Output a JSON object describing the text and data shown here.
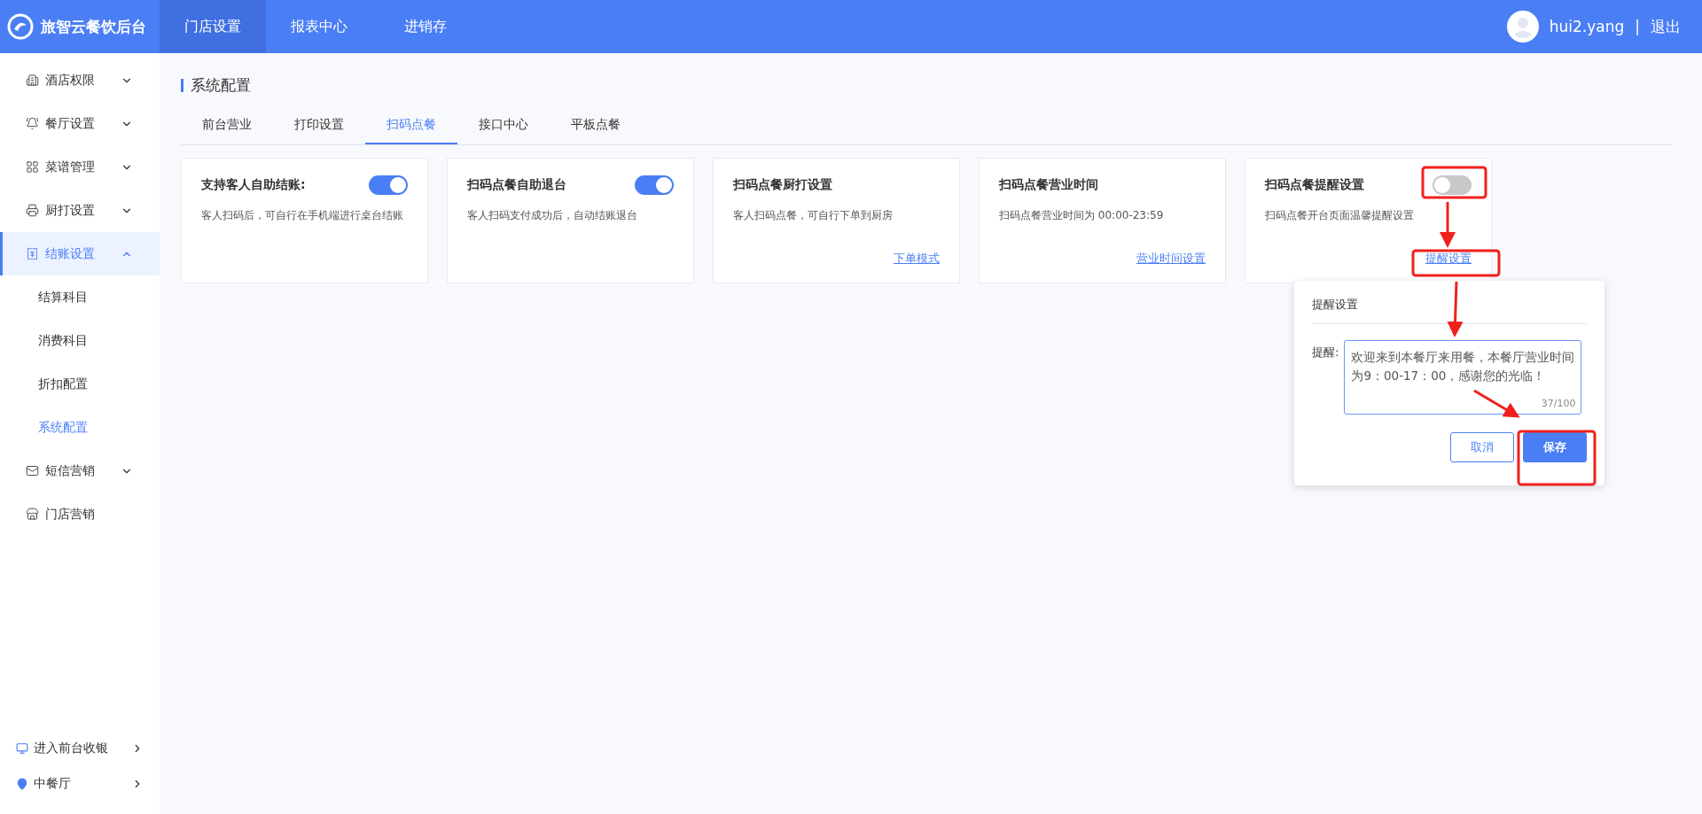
{
  "header": {
    "logo_text": "旅智云餐饮后台",
    "nav": [
      {
        "label": "门店设置",
        "selected": true
      },
      {
        "label": "报表中心",
        "selected": false
      },
      {
        "label": "进销存",
        "selected": false
      }
    ],
    "user": "hui2.yang",
    "separator": "|",
    "logout": "退出"
  },
  "sidebar": {
    "items": [
      {
        "label": "酒店权限",
        "expanded": false,
        "selected": false
      },
      {
        "label": "餐厅设置",
        "expanded": false,
        "selected": false
      },
      {
        "label": "菜谱管理",
        "expanded": false,
        "selected": false
      },
      {
        "label": "厨打设置",
        "expanded": false,
        "selected": false
      },
      {
        "label": "结账设置",
        "expanded": true,
        "selected": true,
        "children": [
          {
            "label": "结算科目",
            "selected": false
          },
          {
            "label": "消费科目",
            "selected": false
          },
          {
            "label": "折扣配置",
            "selected": false
          },
          {
            "label": "系统配置",
            "selected": true
          }
        ]
      },
      {
        "label": "短信营销",
        "expanded": false,
        "selected": false
      },
      {
        "label": "门店营销",
        "selected": false
      }
    ],
    "footer": [
      {
        "label": "进入前台收银"
      },
      {
        "label": "中餐厅"
      }
    ]
  },
  "page": {
    "title": "系统配置",
    "tabs": [
      {
        "label": "前台营业",
        "selected": false
      },
      {
        "label": "打印设置",
        "selected": false
      },
      {
        "label": "扫码点餐",
        "selected": true
      },
      {
        "label": "接口中心",
        "selected": false
      },
      {
        "label": "平板点餐",
        "selected": false
      }
    ],
    "cards": [
      {
        "title": "支持客人自助结账:",
        "on": true,
        "description": "客人扫码后，可自行在手机端进行桌台结账"
      },
      {
        "title": "扫码点餐自助退台",
        "on": true,
        "description": "客人扫码支付成功后，自动结账退台"
      },
      {
        "title": "扫码点餐厨打设置",
        "description": "客人扫码点餐，可自行下单到厨房",
        "link": "下单模式"
      },
      {
        "title": "扫码点餐营业时间",
        "description": "扫码点餐营业时间为 00:00-23:59",
        "link": "营业时间设置"
      },
      {
        "title": "扫码点餐提醒设置",
        "on": false,
        "description": "扫码点餐开台页面温馨提醒设置",
        "link": "提醒设置"
      }
    ]
  },
  "popover": {
    "title": "提醒设置",
    "field_label": "提醒:",
    "value": "欢迎来到本餐厅来用餐，本餐厅营业时间为9：00-17：00，感谢您的光临！",
    "counter": "37/100",
    "buttons": [
      {
        "label": "取消",
        "kind": "secondary"
      },
      {
        "label": "保存",
        "kind": "primary"
      }
    ]
  }
}
